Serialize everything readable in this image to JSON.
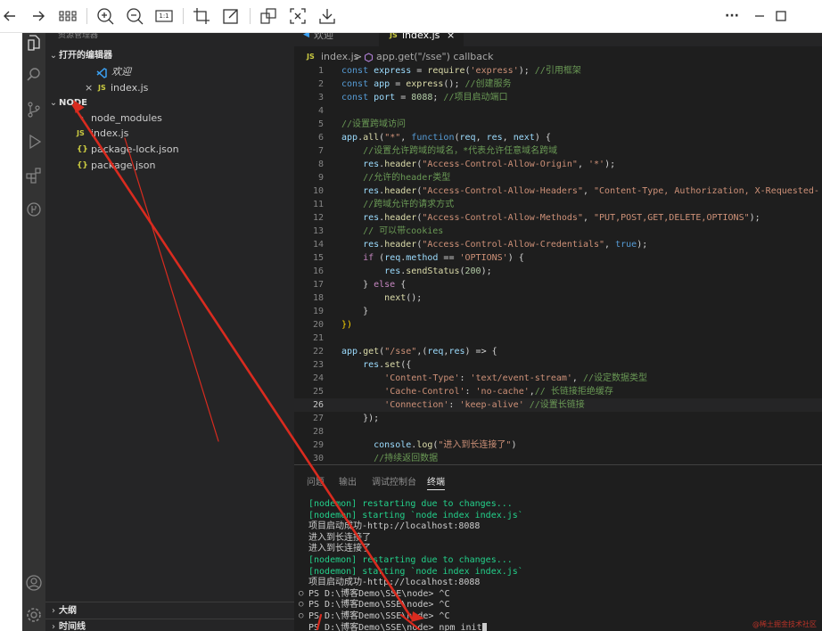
{
  "viewer_toolbar": {
    "icons": [
      "back-icon",
      "forward-icon",
      "grid-view-icon",
      "zoom-in-icon",
      "zoom-out-icon",
      "actual-size-icon",
      "crop-icon",
      "edit-icon",
      "ocr-icon",
      "fit-screen-icon",
      "download-icon",
      "more-icon",
      "minimize-icon",
      "maximize-icon"
    ],
    "one_to_one_label": "1:1",
    "more_label": "···"
  },
  "sidebar": {
    "truncated_header": "资源管理器",
    "open_editors_label": "打开的编辑器",
    "open_editors": [
      {
        "label": "欢迎",
        "icon": "vscode-icon",
        "italic": true
      },
      {
        "label": "index.js",
        "icon": "js-file-icon",
        "close": "×"
      }
    ],
    "folder_label": "NODE",
    "files": [
      {
        "label": "node_modules",
        "type": "folder"
      },
      {
        "label": "index.js",
        "type": "js",
        "badge": "JS"
      },
      {
        "label": "package-lock.json",
        "type": "json",
        "badge": "{}"
      },
      {
        "label": "package.json",
        "type": "json",
        "badge": "{}"
      }
    ],
    "outline_label": "大纲",
    "timeline_label": "时间线"
  },
  "editor": {
    "tabs": [
      {
        "label": "欢迎",
        "active": false
      },
      {
        "label": "index.js",
        "active": true,
        "badge": "JS",
        "close": "×"
      }
    ],
    "breadcrumb": {
      "file": "index.js",
      "separator": ">",
      "symbol": "app.get(\"/sse\") callback",
      "badge": "JS"
    },
    "current_line": 26,
    "start_line": 1
  },
  "code_lines": [
    {
      "t": [
        [
          "const ",
          "k"
        ],
        [
          "express",
          "v"
        ],
        [
          " = ",
          ""
        ],
        [
          "require",
          "f"
        ],
        [
          "(",
          ""
        ],
        [
          "'express'",
          "s"
        ],
        [
          "); ",
          ""
        ],
        [
          "//引用框架",
          "c"
        ]
      ]
    },
    {
      "t": [
        [
          "const ",
          "k"
        ],
        [
          "app",
          "v"
        ],
        [
          " = ",
          ""
        ],
        [
          "express",
          "f"
        ],
        [
          "(); ",
          ""
        ],
        [
          "//创建服务",
          "c"
        ]
      ]
    },
    {
      "t": [
        [
          "const ",
          "k"
        ],
        [
          "port",
          "v"
        ],
        [
          " = ",
          ""
        ],
        [
          "8088",
          "n"
        ],
        [
          "; ",
          ""
        ],
        [
          "//项目启动端口",
          "c"
        ]
      ]
    },
    {
      "t": []
    },
    {
      "t": [
        [
          "//设置跨域访问",
          "c"
        ]
      ]
    },
    {
      "t": [
        [
          "app",
          "v"
        ],
        [
          ".",
          ""
        ],
        [
          "all",
          "f"
        ],
        [
          "(",
          ""
        ],
        [
          "\"*\"",
          "s"
        ],
        [
          ", ",
          ""
        ],
        [
          "function",
          "k"
        ],
        [
          "(",
          ""
        ],
        [
          "req",
          "v"
        ],
        [
          ", ",
          ""
        ],
        [
          "res",
          "v"
        ],
        [
          ", ",
          ""
        ],
        [
          "next",
          "v"
        ],
        [
          ") {",
          ""
        ]
      ]
    },
    {
      "t": [
        [
          "    //设置允许跨域的域名，*代表允许任意域名跨域",
          "c"
        ]
      ]
    },
    {
      "t": [
        [
          "    res",
          "v"
        ],
        [
          ".",
          ""
        ],
        [
          "header",
          "f"
        ],
        [
          "(",
          ""
        ],
        [
          "\"Access-Control-Allow-Origin\"",
          "s"
        ],
        [
          ", ",
          ""
        ],
        [
          "'*'",
          "s"
        ],
        [
          ");",
          ""
        ]
      ]
    },
    {
      "t": [
        [
          "    //允许的header类型",
          "c"
        ]
      ]
    },
    {
      "t": [
        [
          "    res",
          "v"
        ],
        [
          ".",
          ""
        ],
        [
          "header",
          "f"
        ],
        [
          "(",
          ""
        ],
        [
          "\"Access-Control-Allow-Headers\"",
          "s"
        ],
        [
          ", ",
          ""
        ],
        [
          "\"Content-Type, Authorization, X-Requested-",
          "s"
        ]
      ]
    },
    {
      "t": [
        [
          "    //跨域允许的请求方式",
          "c"
        ]
      ]
    },
    {
      "t": [
        [
          "    res",
          "v"
        ],
        [
          ".",
          ""
        ],
        [
          "header",
          "f"
        ],
        [
          "(",
          ""
        ],
        [
          "\"Access-Control-Allow-Methods\"",
          "s"
        ],
        [
          ", ",
          ""
        ],
        [
          "\"PUT,POST,GET,DELETE,OPTIONS\"",
          "s"
        ],
        [
          ");",
          ""
        ]
      ]
    },
    {
      "t": [
        [
          "    // 可以带cookies",
          "c"
        ]
      ]
    },
    {
      "t": [
        [
          "    res",
          "v"
        ],
        [
          ".",
          ""
        ],
        [
          "header",
          "f"
        ],
        [
          "(",
          ""
        ],
        [
          "\"Access-Control-Allow-Credentials\"",
          "s"
        ],
        [
          ", ",
          ""
        ],
        [
          "true",
          "k"
        ],
        [
          ");",
          ""
        ]
      ]
    },
    {
      "t": [
        [
          "    ",
          ""
        ],
        [
          "if",
          "ctl"
        ],
        [
          " (",
          ""
        ],
        [
          "req",
          "v"
        ],
        [
          ".",
          ""
        ],
        [
          "method",
          "v"
        ],
        [
          " == ",
          ""
        ],
        [
          "'OPTIONS'",
          "s"
        ],
        [
          ") {",
          ""
        ]
      ]
    },
    {
      "t": [
        [
          "        res",
          "v"
        ],
        [
          ".",
          ""
        ],
        [
          "sendStatus",
          "f"
        ],
        [
          "(",
          ""
        ],
        [
          "200",
          "n"
        ],
        [
          ");",
          ""
        ]
      ]
    },
    {
      "t": [
        [
          "    } ",
          ""
        ],
        [
          "else",
          "ctl"
        ],
        [
          " {",
          ""
        ]
      ]
    },
    {
      "t": [
        [
          "        ",
          ""
        ],
        [
          "next",
          "f"
        ],
        [
          "();",
          ""
        ]
      ]
    },
    {
      "t": [
        [
          "    }",
          ""
        ]
      ]
    },
    {
      "t": [
        [
          "})",
          "p"
        ]
      ]
    },
    {
      "t": []
    },
    {
      "t": [
        [
          "app",
          "v"
        ],
        [
          ".",
          ""
        ],
        [
          "get",
          "f"
        ],
        [
          "(",
          ""
        ],
        [
          "\"/sse\"",
          "s"
        ],
        [
          ",(",
          ""
        ],
        [
          "req",
          "v"
        ],
        [
          ",",
          ""
        ],
        [
          "res",
          "v"
        ],
        [
          ") => {",
          ""
        ]
      ]
    },
    {
      "t": [
        [
          "    res",
          "v"
        ],
        [
          ".",
          ""
        ],
        [
          "set",
          "f"
        ],
        [
          "({",
          ""
        ]
      ]
    },
    {
      "t": [
        [
          "        ",
          ""
        ],
        [
          "'Content-Type'",
          "s"
        ],
        [
          ": ",
          ""
        ],
        [
          "'text/event-stream'",
          "s"
        ],
        [
          ", ",
          ""
        ],
        [
          "//设定数据类型",
          "c"
        ]
      ]
    },
    {
      "t": [
        [
          "        ",
          ""
        ],
        [
          "'Cache-Control'",
          "s"
        ],
        [
          ": ",
          ""
        ],
        [
          "'no-cache'",
          "s"
        ],
        [
          ",",
          ""
        ],
        [
          "// 长链接拒绝缓存",
          "c"
        ]
      ]
    },
    {
      "t": [
        [
          "        ",
          ""
        ],
        [
          "'Connection'",
          "s"
        ],
        [
          ": ",
          ""
        ],
        [
          "'keep-alive'",
          "s"
        ],
        [
          " ",
          ""
        ],
        [
          "//设置长链接",
          "c"
        ]
      ]
    },
    {
      "t": [
        [
          "    });",
          ""
        ]
      ]
    },
    {
      "t": []
    },
    {
      "t": [
        [
          "      console",
          "v"
        ],
        [
          ".",
          ""
        ],
        [
          "log",
          "f"
        ],
        [
          "(",
          ""
        ],
        [
          "\"进入到长连接了\"",
          "s"
        ],
        [
          ")",
          ""
        ]
      ]
    },
    {
      "t": [
        [
          "      //持续返回数据",
          "c"
        ]
      ]
    }
  ],
  "panel": {
    "tabs": [
      {
        "label": "问题",
        "active": false
      },
      {
        "label": "输出",
        "active": false
      },
      {
        "label": "调试控制台",
        "active": false
      },
      {
        "label": "终端",
        "active": true
      }
    ],
    "terminal_lines": [
      {
        "text": "[nodemon] restarting due to changes...",
        "style": "green"
      },
      {
        "text": "[nodemon] starting `node index index.js`",
        "style": "green"
      },
      {
        "text": "项目启动成功-http://localhost:8088",
        "style": ""
      },
      {
        "text": "进入到长连接了",
        "style": ""
      },
      {
        "text": "进入到长连接了",
        "style": ""
      },
      {
        "text": "[nodemon] restarting due to changes...",
        "style": "green"
      },
      {
        "text": "[nodemon] starting `node index index.js`",
        "style": "green"
      },
      {
        "text": "项目启动成功-http://localhost:8088",
        "style": ""
      },
      {
        "text": "PS D:\\博客Demo\\SSE\\node> ^C",
        "style": "",
        "dot": "○"
      },
      {
        "text": "PS D:\\博客Demo\\SSE\\node> ^C",
        "style": "",
        "dot": "○"
      },
      {
        "text": "PS D:\\博客Demo\\SSE\\node> ^C",
        "style": "",
        "dot": "○"
      },
      {
        "text": "PS D:\\博客Demo\\SSE\\node> npm init",
        "style": "",
        "cursor": true
      }
    ],
    "watermark": "@稀土掘金技术社区"
  },
  "colors": {
    "annotation_arrow": "#d92b1f",
    "editor_bg": "#1e1e1e",
    "sidebar_bg": "#252526",
    "activity_bg": "#333333"
  }
}
